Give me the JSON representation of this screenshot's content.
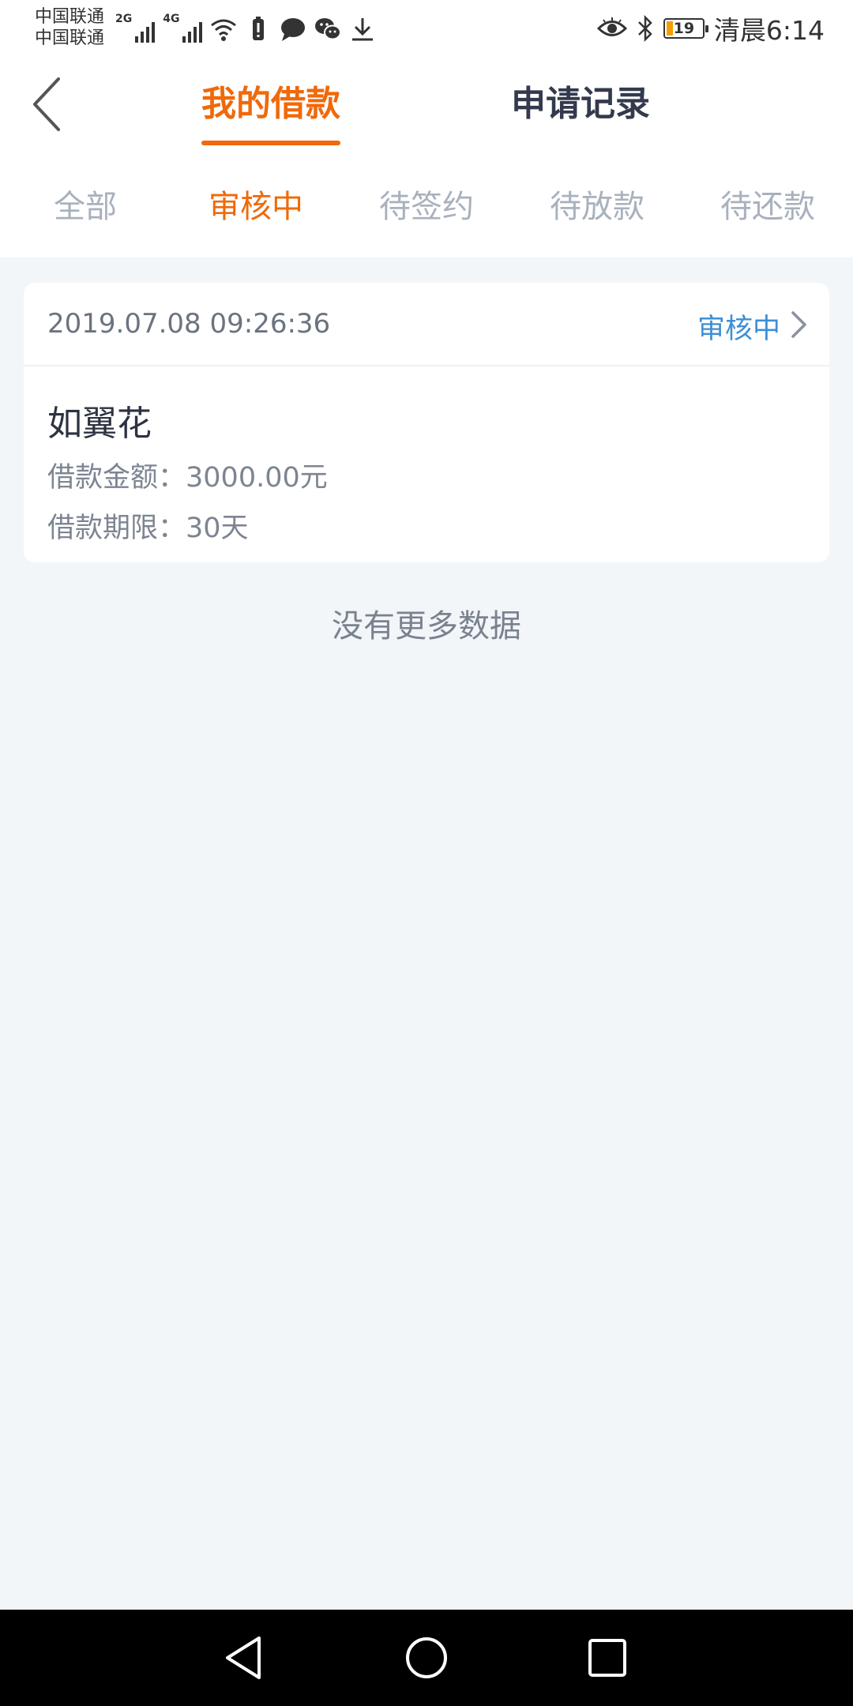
{
  "status_bar": {
    "carrier_1": "中国联通",
    "carrier_2": "中国联通",
    "network_1": "2G",
    "network_2": "4G",
    "battery_level": "19",
    "time": "清晨6:14",
    "left_icons": [
      "signal-bars-icon",
      "signal-bars-icon",
      "wifi-icon",
      "battery-saver-icon",
      "message-bubble-icon",
      "wechat-icon",
      "download-icon"
    ],
    "right_icons": [
      "eye-icon",
      "bluetooth-icon",
      "battery-icon"
    ]
  },
  "header": {
    "tabs": [
      {
        "label": "我的借款",
        "active": true
      },
      {
        "label": "申请记录",
        "active": false
      }
    ]
  },
  "filters": {
    "items": [
      {
        "label": "全部",
        "active": false
      },
      {
        "label": "审核中",
        "active": true
      },
      {
        "label": "待签约",
        "active": false
      },
      {
        "label": "待放款",
        "active": false
      },
      {
        "label": "待还款",
        "active": false
      }
    ]
  },
  "loan_card": {
    "datetime": "2019.07.08 09:26:36",
    "status": "审核中",
    "product_name": "如翼花",
    "amount_label": "借款金额：",
    "amount_value": "3000.00元",
    "term_label": "借款期限：",
    "term_value": "30天"
  },
  "empty_hint": "没有更多数据",
  "colors": {
    "accent": "#f0690a",
    "status_link": "#3d8fd6",
    "page_bg": "#f2f6f9",
    "inactive_tab": "#a8b1bd"
  }
}
